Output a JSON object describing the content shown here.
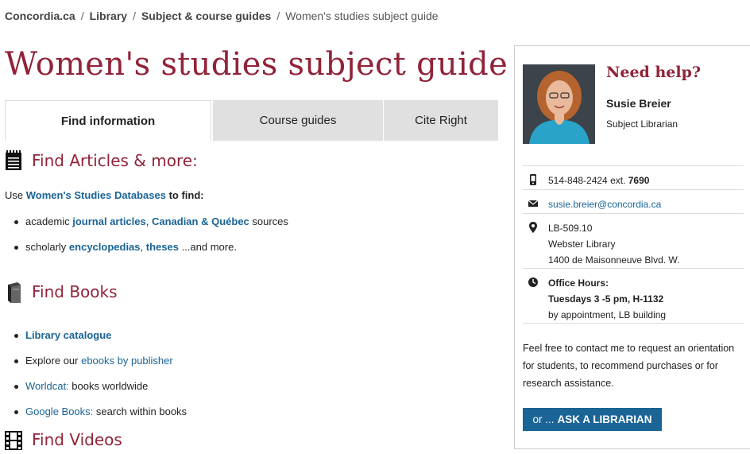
{
  "breadcrumb": {
    "items": [
      "Concordia.ca",
      "Library",
      "Subject & course guides"
    ],
    "current": "Women's studies subject guide",
    "separator": "/"
  },
  "page_title": "Women's studies subject guide",
  "tabs": [
    {
      "label": "Find information",
      "active": true
    },
    {
      "label": "Course guides",
      "active": false
    },
    {
      "label": "Cite Right",
      "active": false
    }
  ],
  "articles": {
    "heading": "Find Articles & more:",
    "icon": "notepad-icon",
    "intro_prefix": "Use ",
    "intro_link": "Women's Studies Databases",
    "intro_suffix": " to find:",
    "items": [
      {
        "prefix": "academic ",
        "link1": "journal articles",
        "mid": ", ",
        "link2": "Canadian & Québec",
        "suffix": " sources"
      },
      {
        "prefix": "scholarly ",
        "link1": "encyclopedias",
        "mid": ", ",
        "link2": "theses",
        "suffix": " ...and more."
      }
    ]
  },
  "books": {
    "heading": "Find Books",
    "icon": "book-icon",
    "items": [
      {
        "link": "Library catalogue",
        "suffix": "",
        "bold": true
      },
      {
        "prefix": "Explore our ",
        "link": "ebooks by publisher",
        "suffix": ""
      },
      {
        "link": "Worldcat:",
        "suffix": " books worldwide"
      },
      {
        "link": "Google Books:",
        "suffix": " search within books"
      }
    ]
  },
  "videos": {
    "heading": "Find Videos",
    "icon": "film-icon"
  },
  "sidebar": {
    "heading": "Need help?",
    "name": "Susie Breier",
    "role": "Subject Librarian",
    "phone": "514-848-2424 ext. ",
    "phone_ext": "7690",
    "email": "susie.breier@concordia.ca",
    "location_lines": [
      "LB-509.10",
      "Webster Library",
      "1400 de Maisonneuve Blvd. W."
    ],
    "hours_label": "Office Hours:",
    "hours_time": "Tuesdays 3 -5 pm, H-1132",
    "hours_note": "by appointment, LB building",
    "note": "Feel free to contact me to request an orientation for students, to recommend purchases or for research assistance.",
    "button_or": "or ...",
    "button_label": "ASK A LIBRARIAN"
  },
  "colors": {
    "brand": "#912338",
    "link": "#1a6496",
    "tab_inactive": "#e0e0e0"
  }
}
